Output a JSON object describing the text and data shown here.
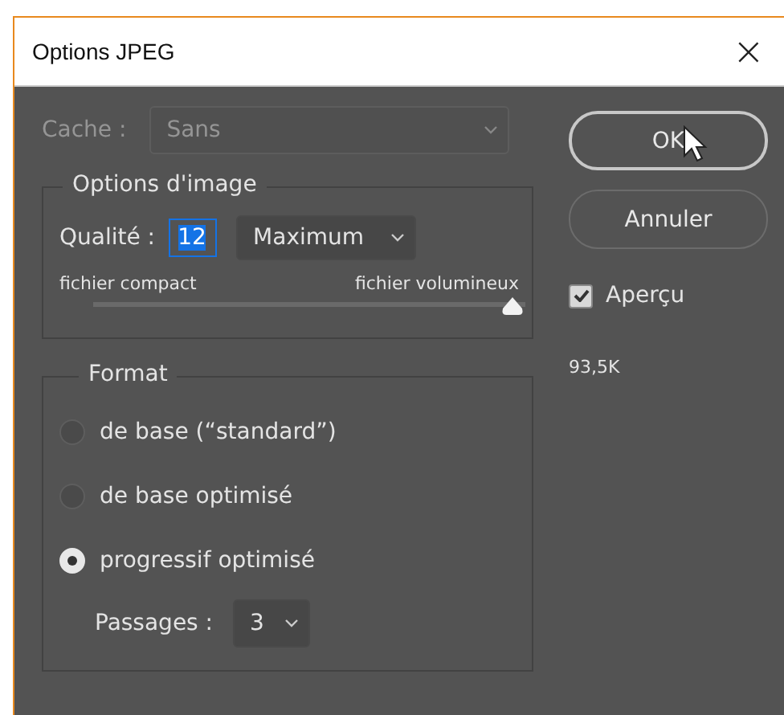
{
  "window": {
    "title": "Options JPEG",
    "close": "×"
  },
  "cache": {
    "label": "Cache :",
    "value": "Sans",
    "disabled": true
  },
  "image_options": {
    "title": "Options d'image",
    "quality_label": "Qualité :",
    "quality_value": "12",
    "preset": "Maximum",
    "slider_min_label": "fichier compact",
    "slider_max_label": "fichier volumineux",
    "level": 1
  },
  "format": {
    "title": "Format",
    "options": [
      {
        "label": "de base  (“standard”)",
        "selected": false
      },
      {
        "label": "de base optimisé",
        "selected": false
      },
      {
        "label": "progressif optimisé",
        "selected": true
      }
    ],
    "passes_label": "Passages :",
    "passes_value": "3"
  },
  "buttons": [
    {
      "label": "OK",
      "default": true
    },
    {
      "label": "Annuler",
      "default": false
    }
  ],
  "preview": {
    "label": "Aperçu",
    "checked": true
  },
  "file_size": "93,5K"
}
